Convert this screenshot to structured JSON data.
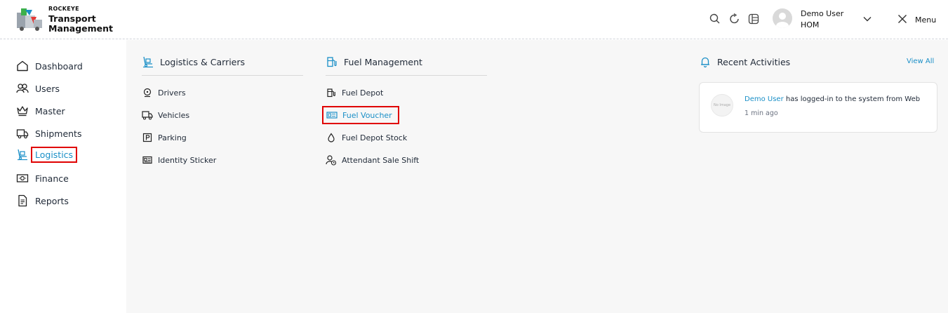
{
  "brand": {
    "small": "ROCKEYE",
    "line1": "Transport",
    "line2": "Management"
  },
  "header": {
    "icons": [
      "search-icon",
      "refresh-icon",
      "layout-icon"
    ],
    "user_name": "Demo User",
    "user_role": "HOM",
    "menu_label": "Menu"
  },
  "sidebar": {
    "items": [
      {
        "label": "Dashboard",
        "icon": "home-icon"
      },
      {
        "label": "Users",
        "icon": "users-icon"
      },
      {
        "label": "Master",
        "icon": "crown-icon"
      },
      {
        "label": "Shipments",
        "icon": "truck-icon"
      },
      {
        "label": "Logistics",
        "icon": "logistics-icon",
        "active": true
      },
      {
        "label": "Finance",
        "icon": "money-icon"
      },
      {
        "label": "Reports",
        "icon": "document-icon"
      }
    ]
  },
  "logistics": {
    "title": "Logistics & Carriers",
    "items": [
      {
        "label": "Drivers",
        "icon": "driver-icon"
      },
      {
        "label": "Vehicles",
        "icon": "truck-icon"
      },
      {
        "label": "Parking",
        "icon": "parking-icon"
      },
      {
        "label": "Identity Sticker",
        "icon": "id-card-icon"
      }
    ]
  },
  "fuel": {
    "title": "Fuel Management",
    "items": [
      {
        "label": "Fuel Depot",
        "icon": "fuel-pump-icon"
      },
      {
        "label": "Fuel Voucher",
        "icon": "voucher-icon",
        "active": true
      },
      {
        "label": "Fuel Depot Stock",
        "icon": "drop-icon"
      },
      {
        "label": "Attendant Sale Shift",
        "icon": "attendant-icon"
      }
    ]
  },
  "activities": {
    "title": "Recent Activities",
    "view_all": "View All",
    "entry": {
      "no_image": "No Image",
      "user": "Demo User",
      "text": " has logged-in to the system from Web",
      "time": "1 min ago"
    }
  },
  "colors": {
    "accent": "#1a8fc7",
    "highlight": "#e00000",
    "panel": "#f7f7f7"
  }
}
